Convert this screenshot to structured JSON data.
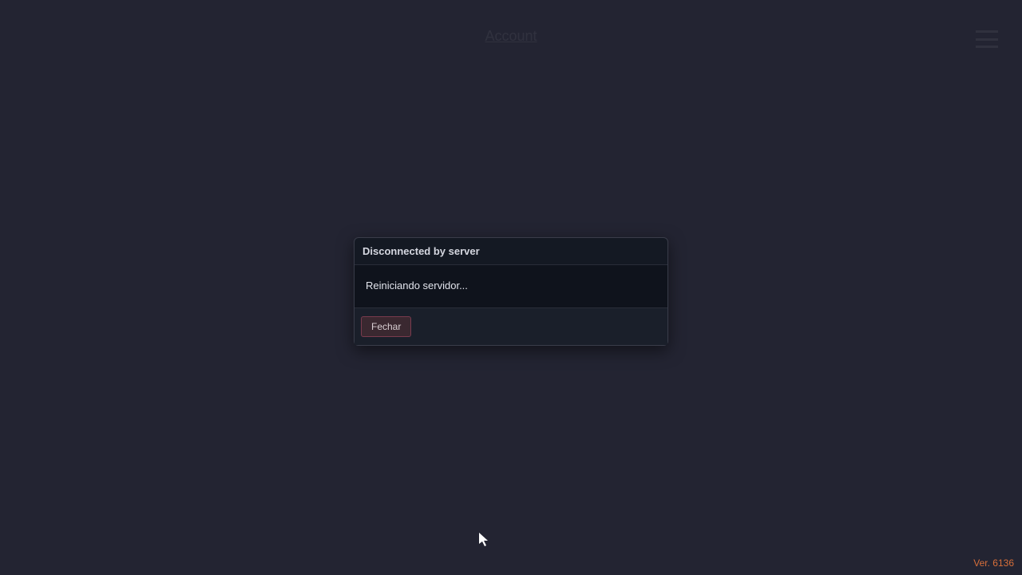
{
  "header": {
    "title": "Account"
  },
  "dialog": {
    "title": "Disconnected by server",
    "message": "Reiniciando servidor...",
    "close_label": "Fechar"
  },
  "footer": {
    "version": "Ver. 6136"
  }
}
